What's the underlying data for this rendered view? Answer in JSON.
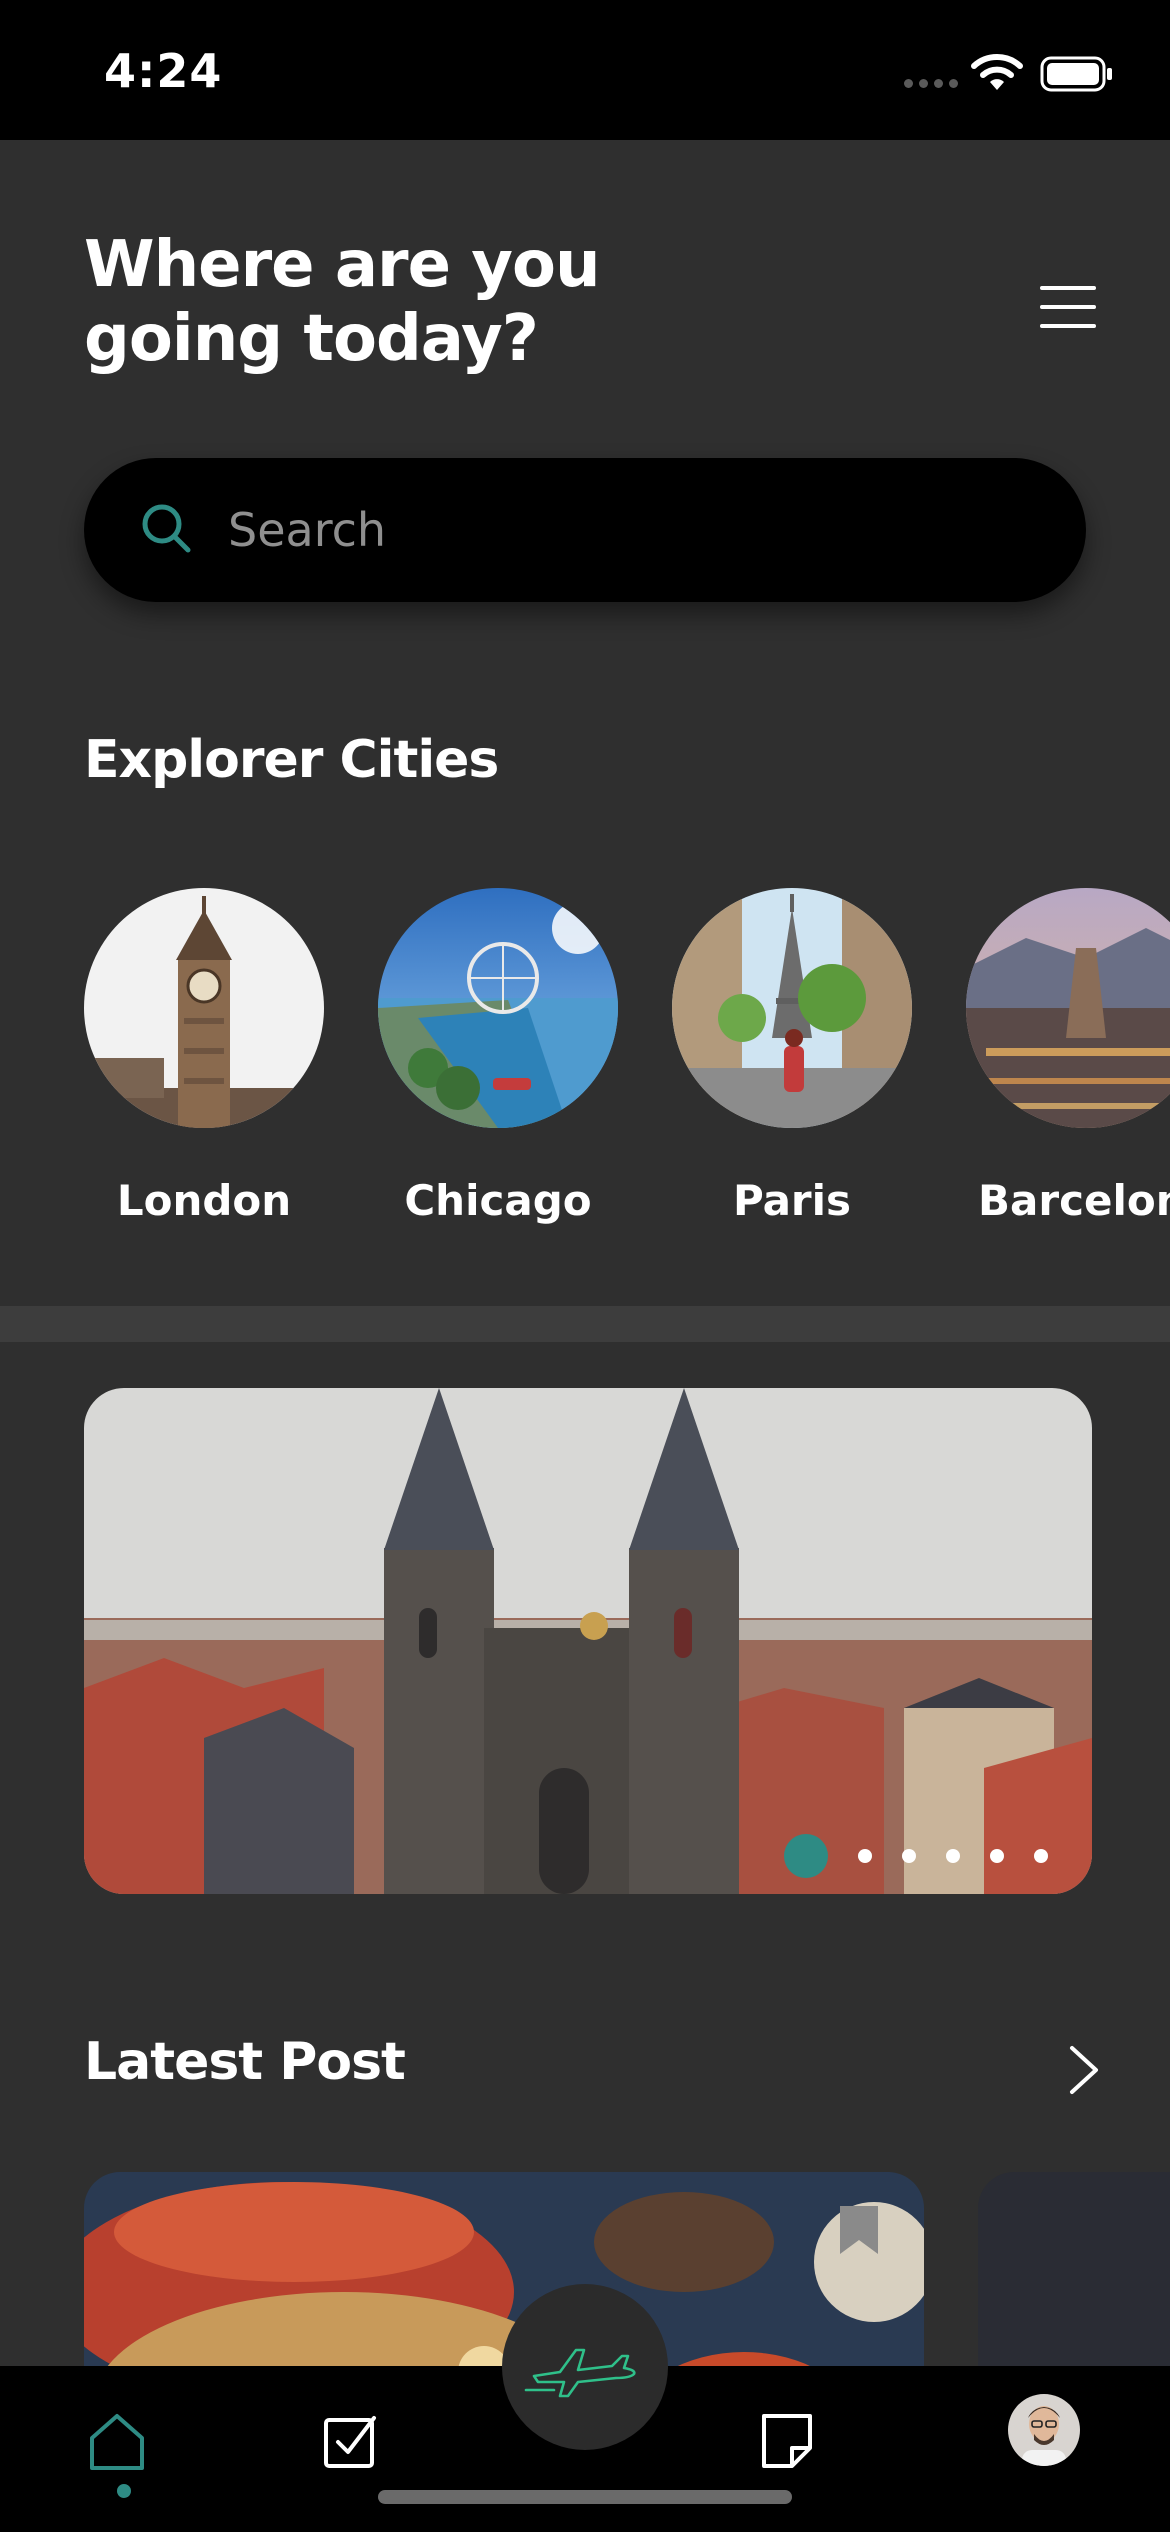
{
  "status_bar": {
    "time": "4:24"
  },
  "header": {
    "title": "Where are you going today?"
  },
  "search": {
    "placeholder": "Search"
  },
  "cities": {
    "title": "Explorer Cities",
    "items": [
      {
        "name": "London"
      },
      {
        "name": "Chicago"
      },
      {
        "name": "Paris"
      },
      {
        "name": "Barcelona"
      }
    ]
  },
  "carousel": {
    "slide_count": 6,
    "active_index": 0
  },
  "latest_post": {
    "title": "Latest Post"
  },
  "colors": {
    "accent": "#2e8b84",
    "background": "#2f2f2f",
    "bar": "#000000"
  },
  "icons": [
    "search-icon",
    "menu-icon",
    "chevron-right-icon",
    "bookmark-icon",
    "home-icon",
    "checkbox-icon",
    "airplane-icon",
    "notes-icon"
  ]
}
